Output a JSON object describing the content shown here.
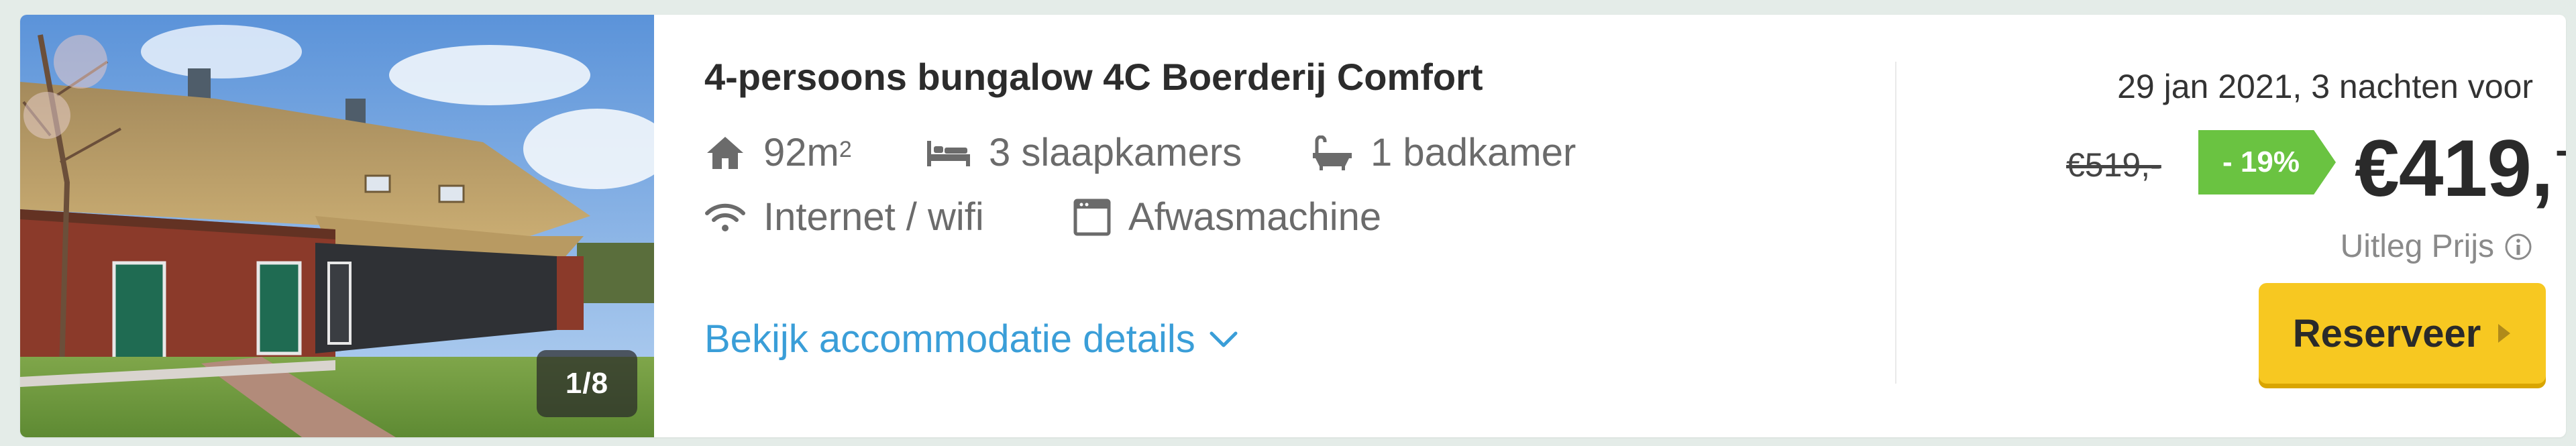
{
  "listing": {
    "photo_counter": "1/8",
    "title": "4-persoons bungalow 4C Boerderij Comfort",
    "features": {
      "area_value": "92m",
      "area_sup": "2",
      "bedrooms": "3 slaapkamers",
      "bathrooms": "1 badkamer",
      "internet": "Internet / wifi",
      "dishwasher": "Afwasmachine"
    },
    "details_link": "Bekijk accommodatie details"
  },
  "pricing": {
    "date_text": "29 jan 2021, 3 nachten voor",
    "old_price": "€519,-",
    "discount": "- 19%",
    "new_price": "€419,",
    "new_price_dash": "-",
    "explanation_link": "Uitleg Prijs",
    "reserve_label": "Reserveer"
  },
  "icons": {
    "area": "house-icon",
    "bedrooms": "bed-icon",
    "bathrooms": "bathtub-icon",
    "internet": "wifi-icon",
    "dishwasher": "dishwasher-icon",
    "details": "chevron-down-icon",
    "info": "info-icon",
    "reserve": "triangle-right-icon"
  },
  "colors": {
    "link": "#3a9ed8",
    "discount_badge": "#6ac341",
    "reserve_button": "#f7c821"
  }
}
